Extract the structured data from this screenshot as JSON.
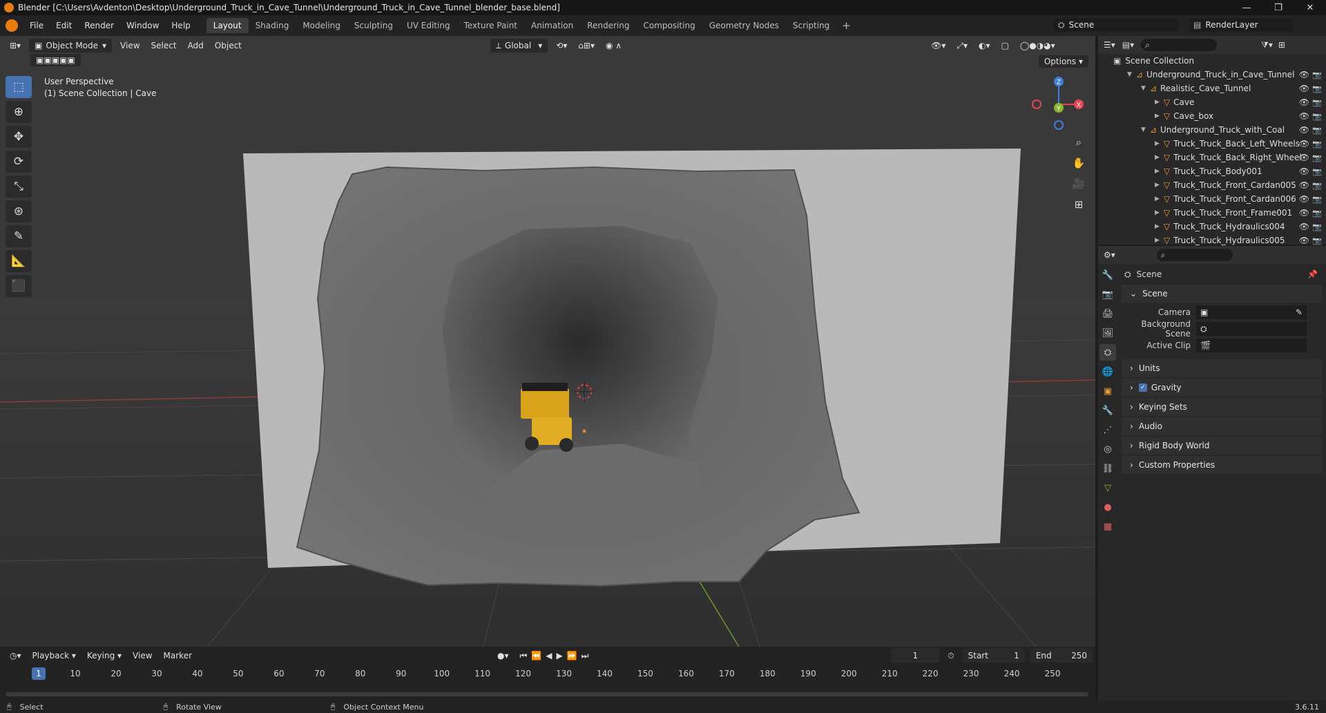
{
  "window": {
    "title": "Blender [C:\\Users\\Avdenton\\Desktop\\Underground_Truck_in_Cave_Tunnel\\Underground_Truck_in_Cave_Tunnel_blender_base.blend]",
    "minimize": "—",
    "maximize": "❐",
    "close": "✕"
  },
  "menu": [
    "File",
    "Edit",
    "Render",
    "Window",
    "Help"
  ],
  "workspaces": [
    "Layout",
    "Shading",
    "Modeling",
    "Sculpting",
    "UV Editing",
    "Texture Paint",
    "Animation",
    "Rendering",
    "Compositing",
    "Geometry Nodes",
    "Scripting"
  ],
  "active_workspace": "Layout",
  "scene_name": "Scene",
  "render_layer": "RenderLayer",
  "viewport": {
    "mode": "Object Mode",
    "menus": [
      "View",
      "Select",
      "Add",
      "Object"
    ],
    "transform_orientation": "Global",
    "options_label": "Options",
    "info_line1": "User Perspective",
    "info_line2": "(1) Scene Collection | Cave",
    "gizmo_axes": {
      "z": "Z",
      "y": "Y",
      "x": "X"
    }
  },
  "timeline": {
    "menus": [
      "Playback",
      "Keying",
      "View",
      "Marker"
    ],
    "current_frame": "1",
    "start_label": "Start",
    "start_value": "1",
    "end_label": "End",
    "end_value": "250",
    "ticks": [
      "1",
      "10",
      "20",
      "30",
      "40",
      "50",
      "60",
      "70",
      "80",
      "90",
      "100",
      "110",
      "120",
      "130",
      "140",
      "150",
      "160",
      "170",
      "180",
      "190",
      "200",
      "210",
      "220",
      "230",
      "240",
      "250"
    ]
  },
  "statusbar": {
    "select": "Select",
    "rotate": "Rotate View",
    "context": "Object Context Menu",
    "version": "3.6.11"
  },
  "outliner": {
    "root": "Scene Collection",
    "items": [
      {
        "label": "Underground_Truck_in_Cave_Tunnel",
        "type": "collection",
        "depth": 1
      },
      {
        "label": "Realistic_Cave_Tunnel",
        "type": "collection",
        "depth": 2
      },
      {
        "label": "Cave",
        "type": "object",
        "depth": 3
      },
      {
        "label": "Cave_box",
        "type": "object",
        "depth": 3
      },
      {
        "label": "Underground_Truck_with_Coal",
        "type": "collection",
        "depth": 2
      },
      {
        "label": "Truck_Truck_Back_Left_Wheels",
        "type": "object",
        "depth": 3
      },
      {
        "label": "Truck_Truck_Back_Right_Wheel",
        "type": "object",
        "depth": 3
      },
      {
        "label": "Truck_Truck_Body001",
        "type": "object",
        "depth": 3
      },
      {
        "label": "Truck_Truck_Front_Cardan005",
        "type": "object",
        "depth": 3
      },
      {
        "label": "Truck_Truck_Front_Cardan006",
        "type": "object",
        "depth": 3
      },
      {
        "label": "Truck_Truck_Front_Frame001",
        "type": "object",
        "depth": 3
      },
      {
        "label": "Truck_Truck_Hydraulics004",
        "type": "object",
        "depth": 3
      },
      {
        "label": "Truck_Truck_Hydraulics005",
        "type": "object",
        "depth": 3
      }
    ]
  },
  "properties": {
    "context_title": "Scene",
    "scene_panel": "Scene",
    "fields": [
      {
        "label": "Camera",
        "value": ""
      },
      {
        "label": "Background Scene",
        "value": ""
      },
      {
        "label": "Active Clip",
        "value": ""
      }
    ],
    "subpanels": [
      "Units",
      "Gravity",
      "Keying Sets",
      "Audio",
      "Rigid Body World",
      "Custom Properties"
    ],
    "gravity_checked": true
  },
  "colors": {
    "accent": "#4772b3",
    "orange": "#e87d0d",
    "x_axis": "#e64553",
    "y_axis": "#8ab82a",
    "z_axis": "#3d7fe0"
  }
}
